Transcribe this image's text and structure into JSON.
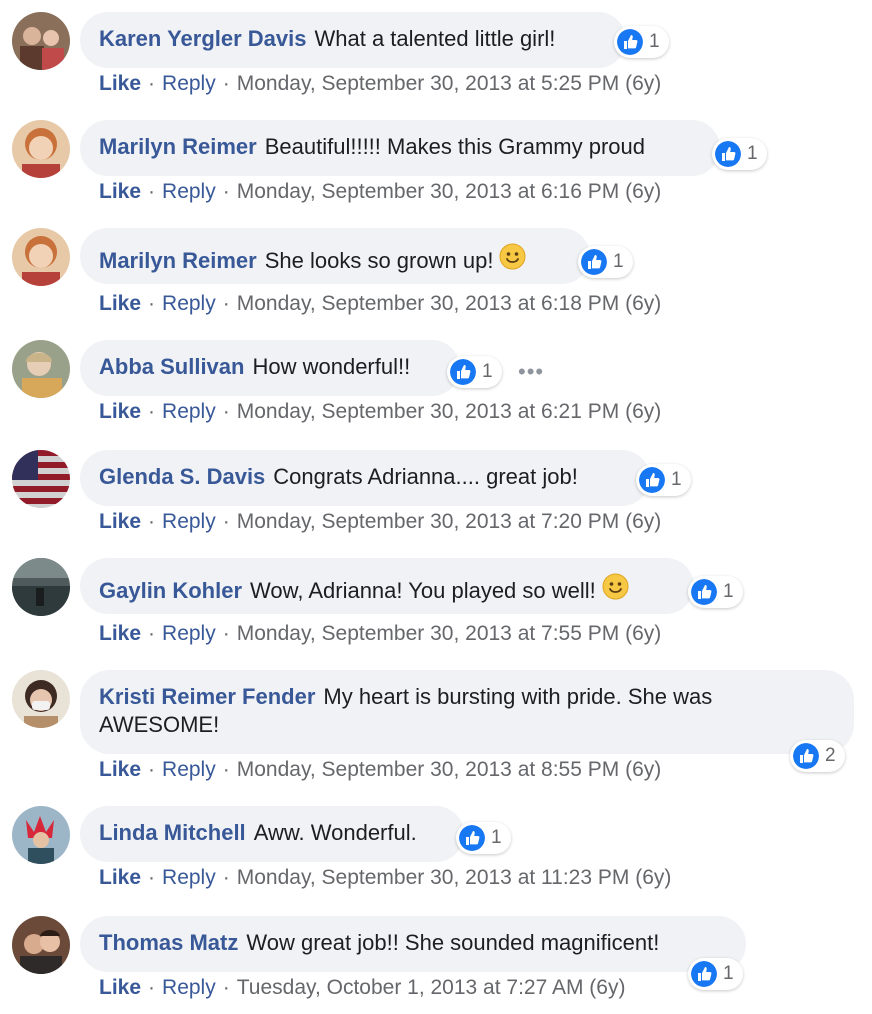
{
  "colors": {
    "author": "#385898",
    "bubble": "#f0f2f5",
    "meta": "#65676b",
    "like_blue": "#1877f2"
  },
  "actions": {
    "like_label": "Like",
    "separator": "·",
    "reply_label": "Reply"
  },
  "more_options_icon": "ellipsis-icon",
  "comments": [
    {
      "author": "Karen Yergler Davis",
      "text": "What a talented little girl!",
      "emoji": "",
      "reaction_icon": "like-reaction-icon",
      "reaction_count": "1",
      "timestamp": "Monday, September 30, 2013 at 5:25 PM (6y)"
    },
    {
      "author": "Marilyn Reimer",
      "text": "Beautiful!!!!! Makes this Grammy proud",
      "emoji": "",
      "reaction_icon": "like-reaction-icon",
      "reaction_count": "1",
      "timestamp": "Monday, September 30, 2013 at 6:16 PM (6y)"
    },
    {
      "author": "Marilyn Reimer",
      "text": "She looks so grown up!",
      "emoji": "smiley-emoji",
      "reaction_icon": "like-reaction-icon",
      "reaction_count": "1",
      "timestamp": "Monday, September 30, 2013 at 6:18 PM (6y)"
    },
    {
      "author": "Abba Sullivan",
      "text": "How wonderful!!",
      "emoji": "",
      "reaction_icon": "like-reaction-icon",
      "reaction_count": "1",
      "timestamp": "Monday, September 30, 2013 at 6:21 PM (6y)"
    },
    {
      "author": "Glenda S. Davis",
      "text": "Congrats Adrianna.... great job!",
      "emoji": "",
      "reaction_icon": "like-reaction-icon",
      "reaction_count": "1",
      "timestamp": "Monday, September 30, 2013 at 7:20 PM (6y)"
    },
    {
      "author": "Gaylin Kohler",
      "text": "Wow, Adrianna! You played so well!",
      "emoji": "smiley-emoji",
      "reaction_icon": "like-reaction-icon",
      "reaction_count": "1",
      "timestamp": "Monday, September 30, 2013 at 7:55 PM (6y)"
    },
    {
      "author": "Kristi Reimer Fender",
      "text": "My heart is bursting with pride. She was AWESOME!",
      "emoji": "",
      "reaction_icon": "like-reaction-icon",
      "reaction_count": "2",
      "timestamp": "Monday, September 30, 2013 at 8:55 PM (6y)"
    },
    {
      "author": "Linda Mitchell",
      "text": "Aww. Wonderful.",
      "emoji": "",
      "reaction_icon": "like-reaction-icon",
      "reaction_count": "1",
      "timestamp": "Monday, September 30, 2013 at 11:23 PM (6y)"
    },
    {
      "author": "Thomas Matz",
      "text": "Wow great job!! She sounded magnificent!",
      "emoji": "",
      "reaction_icon": "like-reaction-icon",
      "reaction_count": "1",
      "timestamp": "Tuesday, October 1, 2013 at 7:27 AM (6y)"
    }
  ]
}
